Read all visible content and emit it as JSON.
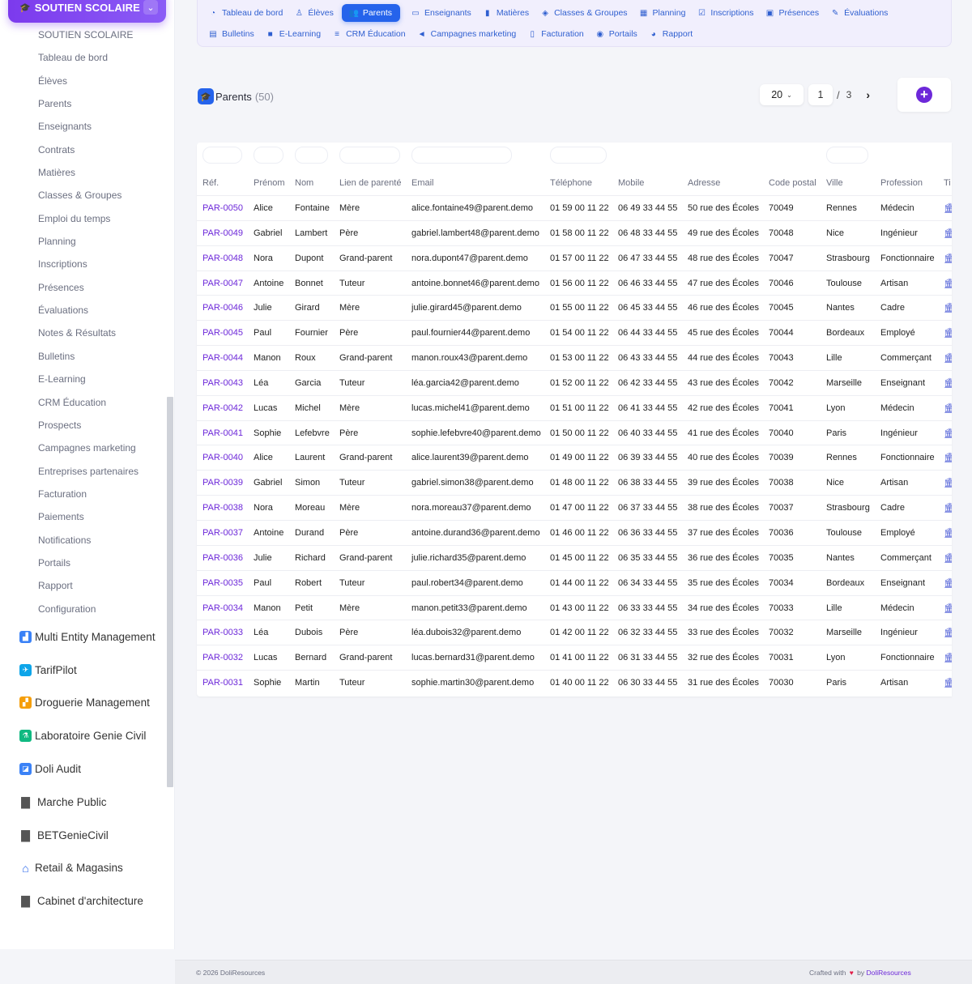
{
  "sidebar": {
    "header_title": "SOUTIEN SCOLAIRE",
    "submenu": [
      "SOUTIEN SCOLAIRE",
      "Tableau de bord",
      "Élèves",
      "Parents",
      "Enseignants",
      "Contrats",
      "Matières",
      "Classes & Groupes",
      "Emploi du temps",
      "Planning",
      "Inscriptions",
      "Présences",
      "Évaluations",
      "Notes & Résultats",
      "Bulletins",
      "E-Learning",
      "CRM Éducation",
      "Prospects",
      "Campagnes marketing",
      "Entreprises partenaires",
      "Facturation",
      "Paiements",
      "Notifications",
      "Portails",
      "Rapport",
      "Configuration"
    ],
    "modules": [
      {
        "label": "Multi Entity Management",
        "icon": "bar-chart-icon",
        "color": "#3b82f6"
      },
      {
        "label": "TarifPilot",
        "icon": "tarif-icon",
        "color": "#0ea5e9"
      },
      {
        "label": "Droguerie Management",
        "icon": "droguerie-icon",
        "color": "#f59e0b"
      },
      {
        "label": "Laboratoire Genie Civil",
        "icon": "lab-icon",
        "color": "#10b981"
      },
      {
        "label": "Doli Audit",
        "icon": "audit-icon",
        "color": "#3b82f6"
      },
      {
        "label": "Marche Public",
        "icon": "document-icon",
        "color": "#555555"
      },
      {
        "label": "BETGenieCivil",
        "icon": "document-icon",
        "color": "#555555"
      },
      {
        "label": "Retail & Magasins",
        "icon": "home-icon",
        "color": "#2563eb"
      },
      {
        "label": "Cabinet d'architecture",
        "icon": "document-icon",
        "color": "#555555"
      }
    ]
  },
  "tabs": {
    "row1": [
      {
        "label": "Tableau de bord",
        "icon": "dashboard-icon",
        "glyph": "◔"
      },
      {
        "label": "Élèves",
        "icon": "student-icon",
        "glyph": "♙"
      },
      {
        "label": "Parents",
        "icon": "users-icon",
        "glyph": "👥",
        "active": true
      },
      {
        "label": "Enseignants",
        "icon": "teacher-icon",
        "glyph": "▭"
      },
      {
        "label": "Matières",
        "icon": "book-icon",
        "glyph": "▮"
      },
      {
        "label": "Classes & Groupes",
        "icon": "layers-icon",
        "glyph": "◈"
      },
      {
        "label": "Planning",
        "icon": "calendar-icon",
        "glyph": "▦"
      },
      {
        "label": "Inscriptions",
        "icon": "clipboard-icon",
        "glyph": "☑"
      },
      {
        "label": "Présences",
        "icon": "check-icon",
        "glyph": "▣"
      },
      {
        "label": "Évaluations",
        "icon": "pencil-icon",
        "glyph": "✎"
      }
    ],
    "row2": [
      {
        "label": "Bulletins",
        "icon": "report-card-icon",
        "glyph": "▤"
      },
      {
        "label": "E-Learning",
        "icon": "video-icon",
        "glyph": "■"
      },
      {
        "label": "CRM Éducation",
        "icon": "list-icon",
        "glyph": "≡"
      },
      {
        "label": "Campagnes marketing",
        "icon": "megaphone-icon",
        "glyph": "◄"
      },
      {
        "label": "Facturation",
        "icon": "invoice-icon",
        "glyph": "▯"
      },
      {
        "label": "Portails",
        "icon": "portal-icon",
        "glyph": "◉"
      },
      {
        "label": "Rapport",
        "icon": "pie-chart-icon",
        "glyph": "◕"
      }
    ]
  },
  "page": {
    "title": "Parents",
    "count": "(50)"
  },
  "pager": {
    "page_size": "20",
    "current": "1",
    "separator": "/",
    "total": "3"
  },
  "table": {
    "columns": [
      "Réf.",
      "Prénom",
      "Nom",
      "Lien de parenté",
      "Email",
      "Téléphone",
      "Mobile",
      "Adresse",
      "Code postal",
      "Ville",
      "Profession",
      "Ti"
    ],
    "rows": [
      [
        "PAR-0050",
        "Alice",
        "Fontaine",
        "Mère",
        "alice.fontaine49@parent.demo",
        "01 59 00 11 22",
        "06 49 33 44 55",
        "50 rue des Écoles",
        "70049",
        "Rennes",
        "Médecin"
      ],
      [
        "PAR-0049",
        "Gabriel",
        "Lambert",
        "Père",
        "gabriel.lambert48@parent.demo",
        "01 58 00 11 22",
        "06 48 33 44 55",
        "49 rue des Écoles",
        "70048",
        "Nice",
        "Ingénieur"
      ],
      [
        "PAR-0048",
        "Nora",
        "Dupont",
        "Grand-parent",
        "nora.dupont47@parent.demo",
        "01 57 00 11 22",
        "06 47 33 44 55",
        "48 rue des Écoles",
        "70047",
        "Strasbourg",
        "Fonctionnaire"
      ],
      [
        "PAR-0047",
        "Antoine",
        "Bonnet",
        "Tuteur",
        "antoine.bonnet46@parent.demo",
        "01 56 00 11 22",
        "06 46 33 44 55",
        "47 rue des Écoles",
        "70046",
        "Toulouse",
        "Artisan"
      ],
      [
        "PAR-0046",
        "Julie",
        "Girard",
        "Mère",
        "julie.girard45@parent.demo",
        "01 55 00 11 22",
        "06 45 33 44 55",
        "46 rue des Écoles",
        "70045",
        "Nantes",
        "Cadre"
      ],
      [
        "PAR-0045",
        "Paul",
        "Fournier",
        "Père",
        "paul.fournier44@parent.demo",
        "01 54 00 11 22",
        "06 44 33 44 55",
        "45 rue des Écoles",
        "70044",
        "Bordeaux",
        "Employé"
      ],
      [
        "PAR-0044",
        "Manon",
        "Roux",
        "Grand-parent",
        "manon.roux43@parent.demo",
        "01 53 00 11 22",
        "06 43 33 44 55",
        "44 rue des Écoles",
        "70043",
        "Lille",
        "Commerçant"
      ],
      [
        "PAR-0043",
        "Léa",
        "Garcia",
        "Tuteur",
        "léa.garcia42@parent.demo",
        "01 52 00 11 22",
        "06 42 33 44 55",
        "43 rue des Écoles",
        "70042",
        "Marseille",
        "Enseignant"
      ],
      [
        "PAR-0042",
        "Lucas",
        "Michel",
        "Mère",
        "lucas.michel41@parent.demo",
        "01 51 00 11 22",
        "06 41 33 44 55",
        "42 rue des Écoles",
        "70041",
        "Lyon",
        "Médecin"
      ],
      [
        "PAR-0041",
        "Sophie",
        "Lefebvre",
        "Père",
        "sophie.lefebvre40@parent.demo",
        "01 50 00 11 22",
        "06 40 33 44 55",
        "41 rue des Écoles",
        "70040",
        "Paris",
        "Ingénieur"
      ],
      [
        "PAR-0040",
        "Alice",
        "Laurent",
        "Grand-parent",
        "alice.laurent39@parent.demo",
        "01 49 00 11 22",
        "06 39 33 44 55",
        "40 rue des Écoles",
        "70039",
        "Rennes",
        "Fonctionnaire"
      ],
      [
        "PAR-0039",
        "Gabriel",
        "Simon",
        "Tuteur",
        "gabriel.simon38@parent.demo",
        "01 48 00 11 22",
        "06 38 33 44 55",
        "39 rue des Écoles",
        "70038",
        "Nice",
        "Artisan"
      ],
      [
        "PAR-0038",
        "Nora",
        "Moreau",
        "Mère",
        "nora.moreau37@parent.demo",
        "01 47 00 11 22",
        "06 37 33 44 55",
        "38 rue des Écoles",
        "70037",
        "Strasbourg",
        "Cadre"
      ],
      [
        "PAR-0037",
        "Antoine",
        "Durand",
        "Père",
        "antoine.durand36@parent.demo",
        "01 46 00 11 22",
        "06 36 33 44 55",
        "37 rue des Écoles",
        "70036",
        "Toulouse",
        "Employé"
      ],
      [
        "PAR-0036",
        "Julie",
        "Richard",
        "Grand-parent",
        "julie.richard35@parent.demo",
        "01 45 00 11 22",
        "06 35 33 44 55",
        "36 rue des Écoles",
        "70035",
        "Nantes",
        "Commerçant"
      ],
      [
        "PAR-0035",
        "Paul",
        "Robert",
        "Tuteur",
        "paul.robert34@parent.demo",
        "01 44 00 11 22",
        "06 34 33 44 55",
        "35 rue des Écoles",
        "70034",
        "Bordeaux",
        "Enseignant"
      ],
      [
        "PAR-0034",
        "Manon",
        "Petit",
        "Mère",
        "manon.petit33@parent.demo",
        "01 43 00 11 22",
        "06 33 33 44 55",
        "34 rue des Écoles",
        "70033",
        "Lille",
        "Médecin"
      ],
      [
        "PAR-0033",
        "Léa",
        "Dubois",
        "Père",
        "léa.dubois32@parent.demo",
        "01 42 00 11 22",
        "06 32 33 44 55",
        "33 rue des Écoles",
        "70032",
        "Marseille",
        "Ingénieur"
      ],
      [
        "PAR-0032",
        "Lucas",
        "Bernard",
        "Grand-parent",
        "lucas.bernard31@parent.demo",
        "01 41 00 11 22",
        "06 31 33 44 55",
        "32 rue des Écoles",
        "70031",
        "Lyon",
        "Fonctionnaire"
      ],
      [
        "PAR-0031",
        "Sophie",
        "Martin",
        "Tuteur",
        "sophie.martin30@parent.demo",
        "01 40 00 11 22",
        "06 30 33 44 55",
        "31 rue des Écoles",
        "70030",
        "Paris",
        "Artisan"
      ]
    ]
  },
  "footer": {
    "copyright": "© 2026 DoliResources",
    "crafted": "Crafted with",
    "by": "by",
    "brand": "DoliResources"
  },
  "colors": {
    "accent": "#2563eb",
    "brand": "#6d28d9",
    "heart": "#e11d48"
  }
}
